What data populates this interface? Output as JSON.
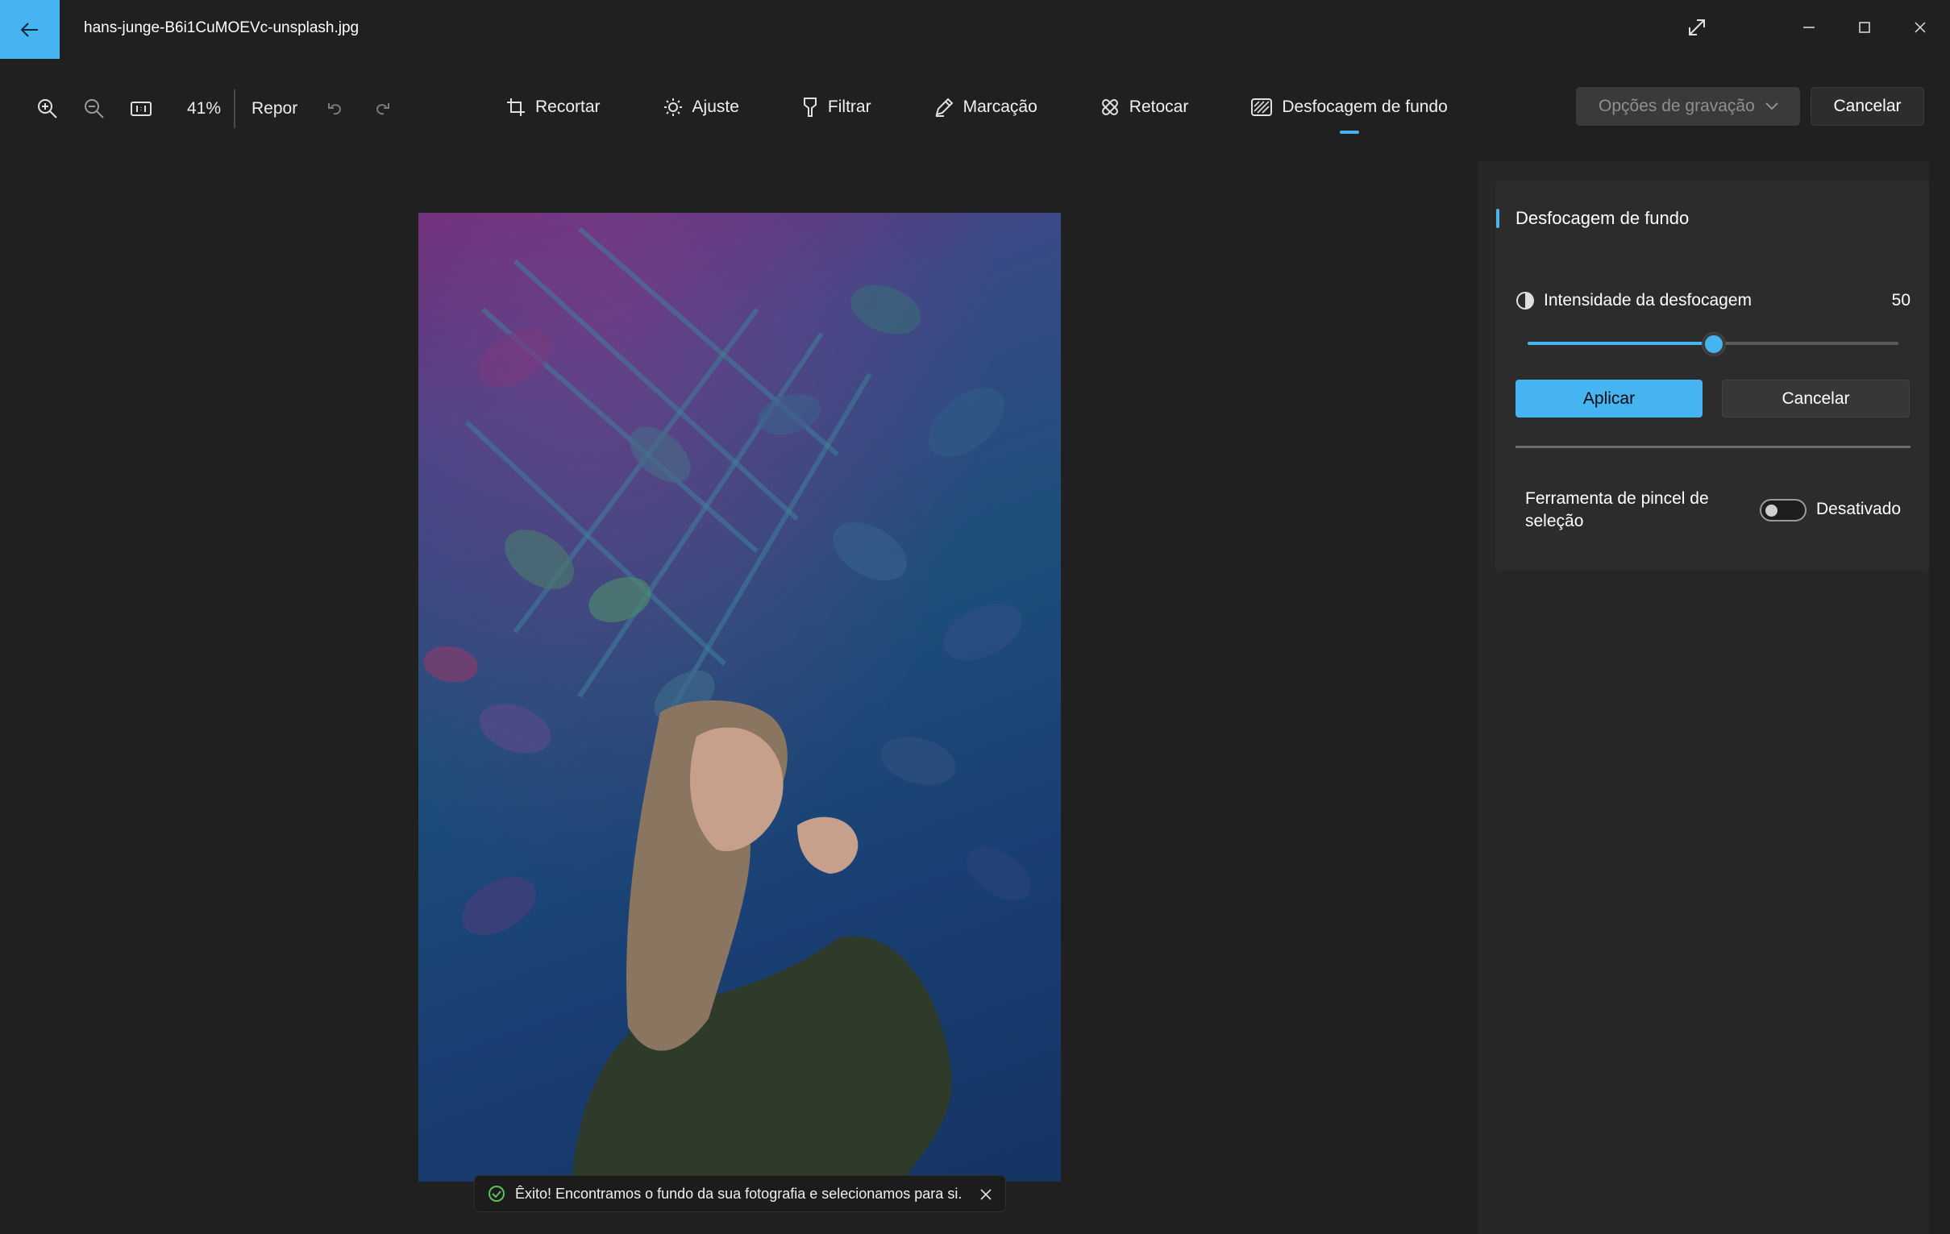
{
  "window": {
    "filename": "hans-junge-B6i1CuMOEVc-unsplash.jpg"
  },
  "view_toolbar": {
    "zoom_level": "41%",
    "reset_label": "Repor"
  },
  "edit_tools": [
    {
      "label": "Recortar",
      "icon": "crop-icon"
    },
    {
      "label": "Ajuste",
      "icon": "brightness-icon"
    },
    {
      "label": "Filtrar",
      "icon": "filter-icon"
    },
    {
      "label": "Marcação",
      "icon": "pen-icon"
    },
    {
      "label": "Retocar",
      "icon": "retouch-icon"
    },
    {
      "label": "Desfocagem de fundo",
      "icon": "background-blur-icon",
      "active": true
    }
  ],
  "header_actions": {
    "save_options_label": "Opções de gravação",
    "cancel_label": "Cancelar"
  },
  "panel": {
    "title": "Desfocagem de fundo",
    "intensity_label": "Intensidade da desfocagem",
    "intensity_value": "50",
    "slider_fraction": 0.5,
    "apply_label": "Aplicar",
    "cancel_label": "Cancelar",
    "brush_tool_label": "Ferramenta de pincel de seleção",
    "brush_tool_state": "Desativado"
  },
  "toast": {
    "message": "Êxito! Encontramos o fundo da sua fotografia e selecionamos para si."
  },
  "colors": {
    "accent": "#45b4f0",
    "background": "#202020",
    "panel": "#2c2c2c"
  }
}
